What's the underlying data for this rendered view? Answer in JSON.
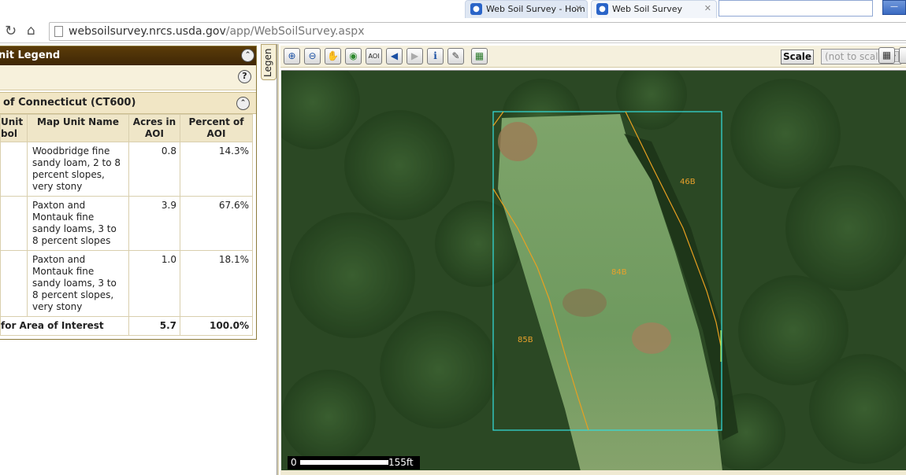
{
  "browser": {
    "tabs": [
      {
        "label": "Web Soil Survey - Hom"
      },
      {
        "label": "Web Soil Survey"
      }
    ],
    "url_host": "websoilsurvey.nrcs.usda.gov",
    "url_path": "/app/WebSoilSurvey.aspx"
  },
  "legend": {
    "title": "nit Legend",
    "side_tab_label": "Legen",
    "survey_area_title": "of Connecticut (CT600)",
    "columns": [
      "Unit\nbol",
      "Map Unit Name",
      "Acres in AOI",
      "Percent of AOI"
    ],
    "rows": [
      {
        "symbol": "",
        "name": "Woodbridge fine sandy loam, 2 to 8 percent slopes, very stony",
        "acres": "0.8",
        "percent": "14.3%"
      },
      {
        "symbol": "",
        "name": "Paxton and Montauk fine sandy loams, 3 to 8 percent slopes",
        "acres": "3.9",
        "percent": "67.6%"
      },
      {
        "symbol": "",
        "name": "Paxton and Montauk fine sandy loams, 3 to 8 percent slopes, very stony",
        "acres": "1.0",
        "percent": "18.1%"
      }
    ],
    "total": {
      "label": " for Area of Interest",
      "acres": "5.7",
      "percent": "100.0%"
    }
  },
  "toolbar": {
    "tools": [
      "zoom-in-icon",
      "zoom-out-icon",
      "pan-hand-icon",
      "full-extent-globe-icon",
      "aoi-icon",
      "back-arrow-icon",
      "forward-arrow-icon",
      "identify-info-icon",
      "measure-ruler-icon",
      "clear-selection-icon"
    ],
    "scale_label": "Scale",
    "scale_value": "(not to scale)"
  },
  "map": {
    "labels": {
      "46b": "46B",
      "84b": "84B",
      "85b": "85B"
    },
    "scale_zero": "0",
    "scale_distance": "155ft"
  }
}
